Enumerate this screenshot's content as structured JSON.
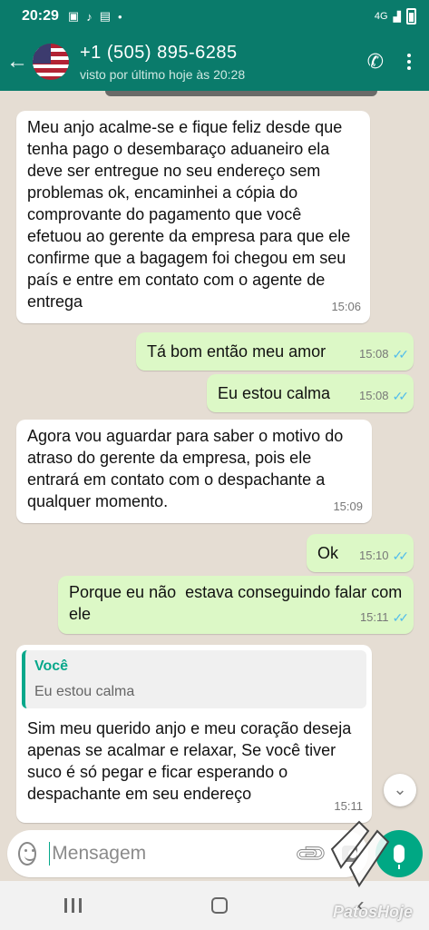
{
  "status_bar": {
    "time": "20:29",
    "network": "4G"
  },
  "header": {
    "contact_name": "+1 (505) 895-6285",
    "last_seen": "visto por último hoje às 20:28"
  },
  "messages": [
    {
      "direction": "incoming",
      "text": "Meu anjo acalme-se e fique feliz desde que tenha pago o desembaraço aduaneiro ela deve ser entregue no seu endereço sem problemas ok, encaminhei a cópia do comprovante do pagamento que você efetuou ao gerente da empresa para que ele confirme que a bagagem foi chegou em seu país e entre em contato com o agente de entrega",
      "time": "15:06"
    },
    {
      "direction": "outgoing",
      "text": "Tá bom então meu amor",
      "time": "15:08",
      "ticks": "✓✓"
    },
    {
      "direction": "outgoing",
      "text": "Eu estou calma",
      "time": "15:08",
      "ticks": "✓✓"
    },
    {
      "direction": "incoming",
      "text": "Agora vou aguardar para saber o motivo do atraso do gerente da empresa, pois ele entrará em contato com o despachante a qualquer momento.",
      "time": "15:09"
    },
    {
      "direction": "outgoing",
      "text": "Ok",
      "time": "15:10",
      "ticks": "✓✓"
    },
    {
      "direction": "outgoing",
      "text": "Porque eu não  estava conseguindo falar com ele",
      "time": "15:11",
      "ticks": "✓✓"
    },
    {
      "direction": "incoming",
      "quote_author": "Você",
      "quote_text": "Eu estou calma",
      "text": "Sim meu querido anjo e meu coração deseja apenas se acalmar e relaxar, Se você tiver suco é só pegar e ficar esperando o despachante em seu endereço",
      "time": "15:11"
    }
  ],
  "input": {
    "placeholder": "Mensagem"
  },
  "watermark": "PatosHoje",
  "colors": {
    "header": "#0a7b6b",
    "outgoing_bubble": "#dcf8c6",
    "accent": "#06a88b",
    "read_ticks": "#53bdeb"
  },
  "icons": [
    "back-arrow-icon",
    "add-call-icon",
    "more-options-icon",
    "emoji-icon",
    "attach-icon",
    "camera-icon",
    "mic-icon",
    "scroll-down-icon"
  ]
}
